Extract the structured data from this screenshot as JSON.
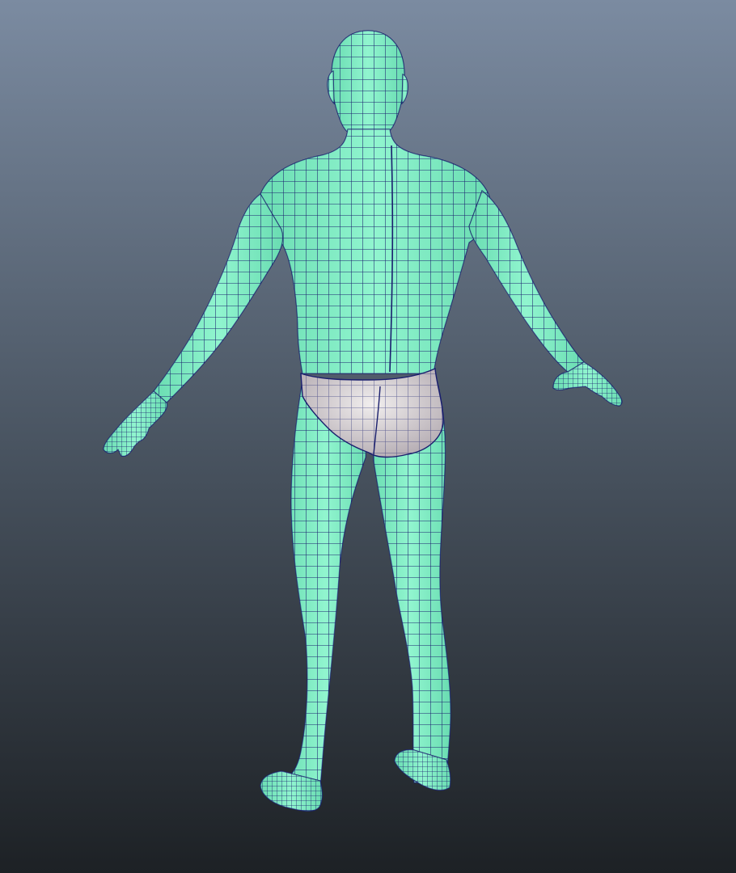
{
  "viewport": {
    "background_top": "#7b8ba1",
    "background_mid": "#4a5562",
    "background_bottom": "#1d2125"
  },
  "model": {
    "skin_color": "#7ff0c4",
    "skin_highlight": "#a6fbdc",
    "skin_shadow": "#4fc49b",
    "wire_color": "#1a1f6e",
    "underwear_color": "#f1eeee",
    "underwear_shadow": "#b8b0b6"
  }
}
